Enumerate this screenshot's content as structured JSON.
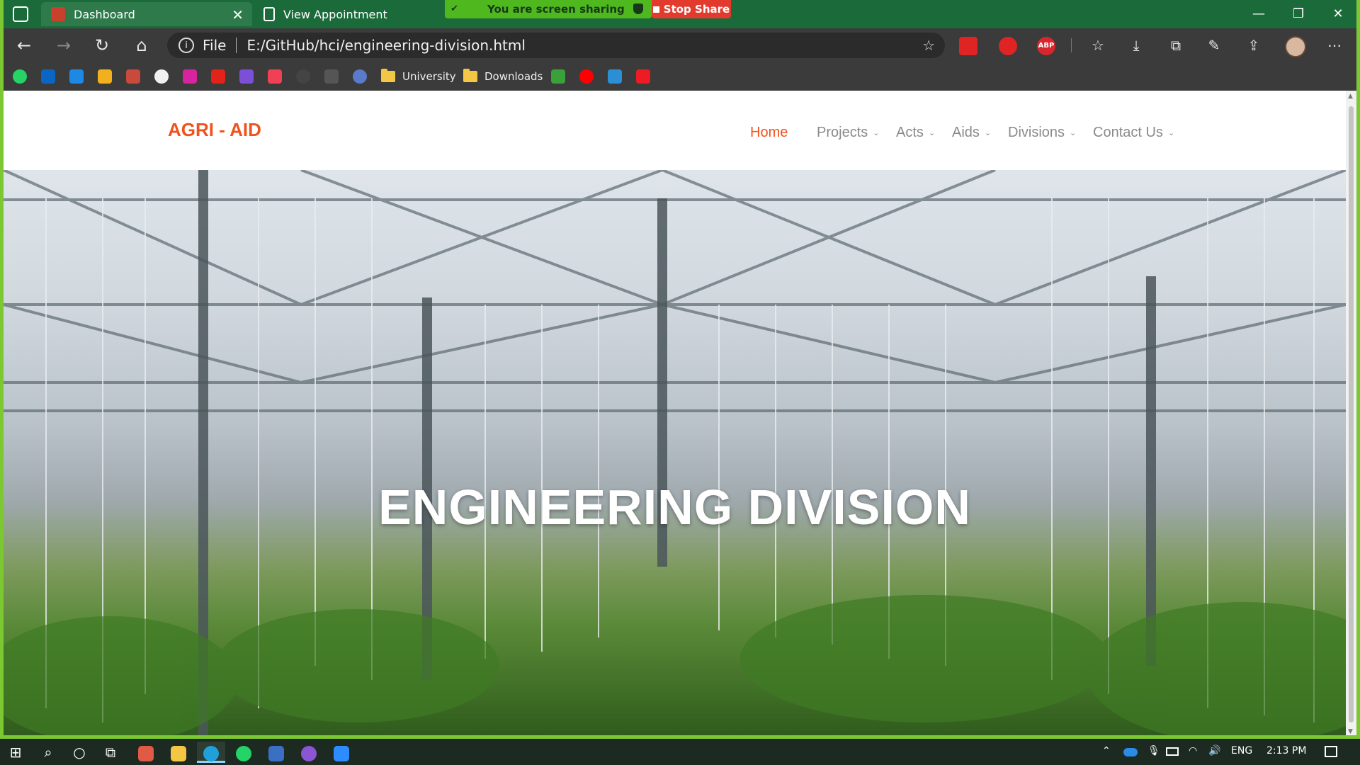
{
  "browser": {
    "tabs": [
      {
        "title": "Dashboard",
        "active": true
      },
      {
        "title": "View Appointment",
        "active": false
      }
    ],
    "screen_share": {
      "status_text": "You are screen sharing",
      "stop_label": "Stop Share"
    },
    "address": {
      "scheme_label": "File",
      "url": "E:/GitHub/hci/engineering-division.html"
    },
    "extensions": [
      {
        "name": "extension-red-icon",
        "color": "#e02424",
        "label": ""
      },
      {
        "name": "extension-shield-icon",
        "color": "#e02424",
        "label": ""
      },
      {
        "name": "adblock-icon",
        "color": "#d8262c",
        "label": "ABP"
      }
    ],
    "bookmarks": {
      "folders": [
        {
          "label": "University"
        },
        {
          "label": "Downloads"
        }
      ]
    }
  },
  "site": {
    "logo": "AGRI - AID",
    "nav": [
      {
        "label": "Home",
        "active": true,
        "dropdown": false
      },
      {
        "label": "Projects",
        "active": false,
        "dropdown": true
      },
      {
        "label": "Acts",
        "active": false,
        "dropdown": true
      },
      {
        "label": "Aids",
        "active": false,
        "dropdown": true
      },
      {
        "label": "Divisions",
        "active": false,
        "dropdown": true
      },
      {
        "label": "Contact Us",
        "active": false,
        "dropdown": true
      }
    ],
    "hero_title": "ENGINEERING DIVISION"
  },
  "taskbar": {
    "language": "ENG",
    "time": "2:13 PM"
  },
  "colors": {
    "accent": "#f0531d",
    "nav_text": "#8a8a8a",
    "share_green": "#4fb81e",
    "stop_red": "#e23b2d"
  }
}
